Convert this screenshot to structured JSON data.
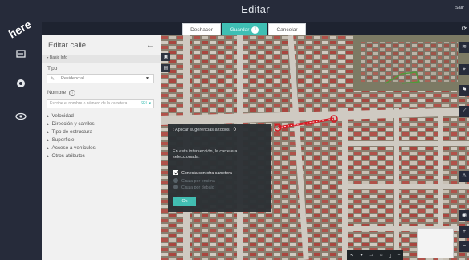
{
  "app": {
    "title": "Editar",
    "user_link": "Salir"
  },
  "actions": {
    "undo": "Deshacer",
    "save": "Guardar",
    "save_count": "1",
    "cancel": "Cancelar"
  },
  "panel": {
    "title": "Editar calle",
    "subtitle": "▸ Basic Info",
    "type_label": "Tipo",
    "type_value": "Residencial",
    "name_label": "Nombre",
    "name_placeholder": "Escribe el nombre o número de la carretera",
    "name_lang": "SPL ▾",
    "sections": [
      "Velocidad",
      "Dirección y carriles",
      "Tipo de estructura",
      "Superficie",
      "Acceso a vehículos",
      "Otros atributos"
    ]
  },
  "dialog": {
    "header": "‹ Aplicar sugerencias a todos",
    "count": "0",
    "text": "En esta intersección, la carretera seleccionada:",
    "options": [
      {
        "label": "Conecta con otra carretera",
        "type": "checkbox",
        "checked": true
      },
      {
        "label": "Cruza por encima",
        "type": "radio",
        "checked": false
      },
      {
        "label": "Cruza por debajo",
        "type": "radio",
        "checked": false
      }
    ],
    "ok": "Ok"
  },
  "map_tools": {
    "right": [
      "layers-icon",
      "satellite-icon",
      "pin-icon",
      "ruler-icon",
      "warning-icon",
      "locate-icon",
      "zoom-in-icon",
      "zoom-out-icon"
    ],
    "bottom": [
      "cursor-icon",
      "node-icon",
      "arrow-icon",
      "lock-icon",
      "trash-icon",
      "dash-icon"
    ]
  },
  "colors": {
    "accent": "#3fbfb4",
    "chrome": "#262b3a",
    "selection": "#d71923"
  }
}
